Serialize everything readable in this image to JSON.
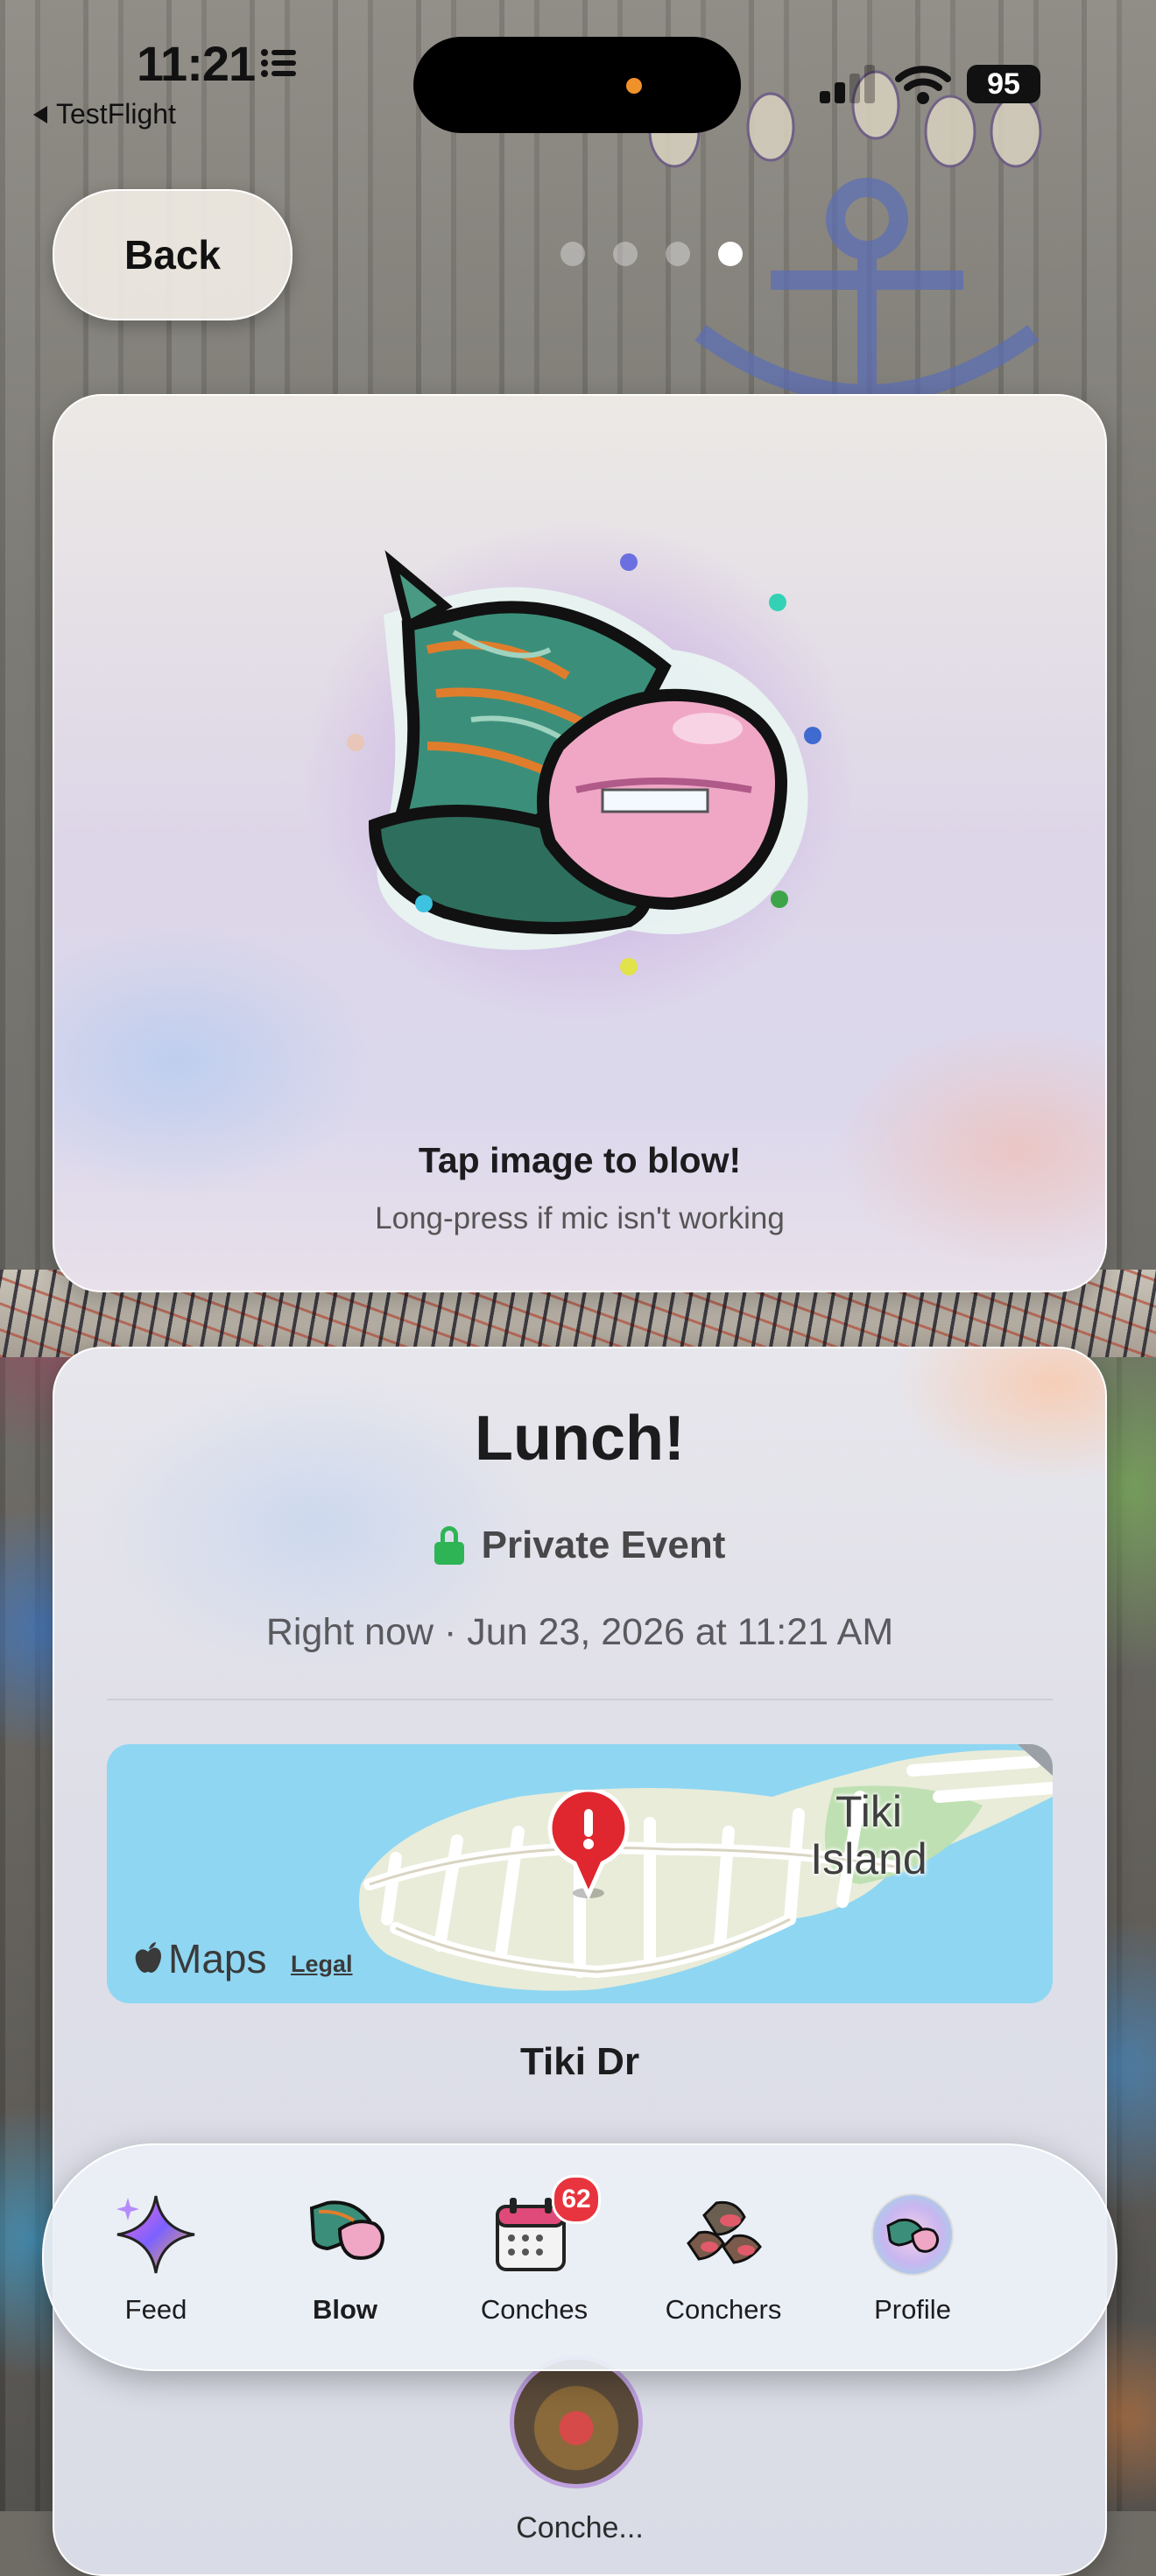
{
  "status_bar": {
    "time": "11:21",
    "back_app": "TestFlight",
    "battery": "95",
    "icons": [
      "list-icon",
      "signal-icon",
      "wifi-icon",
      "battery-icon"
    ]
  },
  "nav": {
    "back_label": "Back",
    "pager": {
      "count": 4,
      "active_index": 3
    }
  },
  "blow_card": {
    "image_icon": "conch-shell-lips-icon",
    "title": "Tap image to blow!",
    "subtitle": "Long-press if mic isn't working"
  },
  "event": {
    "title": "Lunch!",
    "privacy": "Private Event",
    "privacy_icon": "lock-icon",
    "date": "Right now · Jun 23, 2026 at 11:21 AM",
    "map": {
      "brand": "Maps",
      "legal": "Legal",
      "place_label_line1": "Tiki",
      "place_label_line2": "Island"
    },
    "street": "Tiki Dr",
    "conchers_caption": "Conche..."
  },
  "tabbar": {
    "items": [
      {
        "label": "Feed",
        "icon": "sparkle-icon",
        "active": false
      },
      {
        "label": "Blow",
        "icon": "conch-icon",
        "active": true
      },
      {
        "label": "Conches",
        "icon": "calendar-icon",
        "active": false,
        "badge": "62"
      },
      {
        "label": "Conchers",
        "icon": "conchers-group-icon",
        "active": false
      },
      {
        "label": "Profile",
        "icon": "profile-avatar-icon",
        "active": false
      }
    ]
  },
  "colors": {
    "lock_green": "#2fb455",
    "badge_red": "#e8343e",
    "map_water": "#8fd6f2",
    "pin_red": "#e0262e"
  }
}
